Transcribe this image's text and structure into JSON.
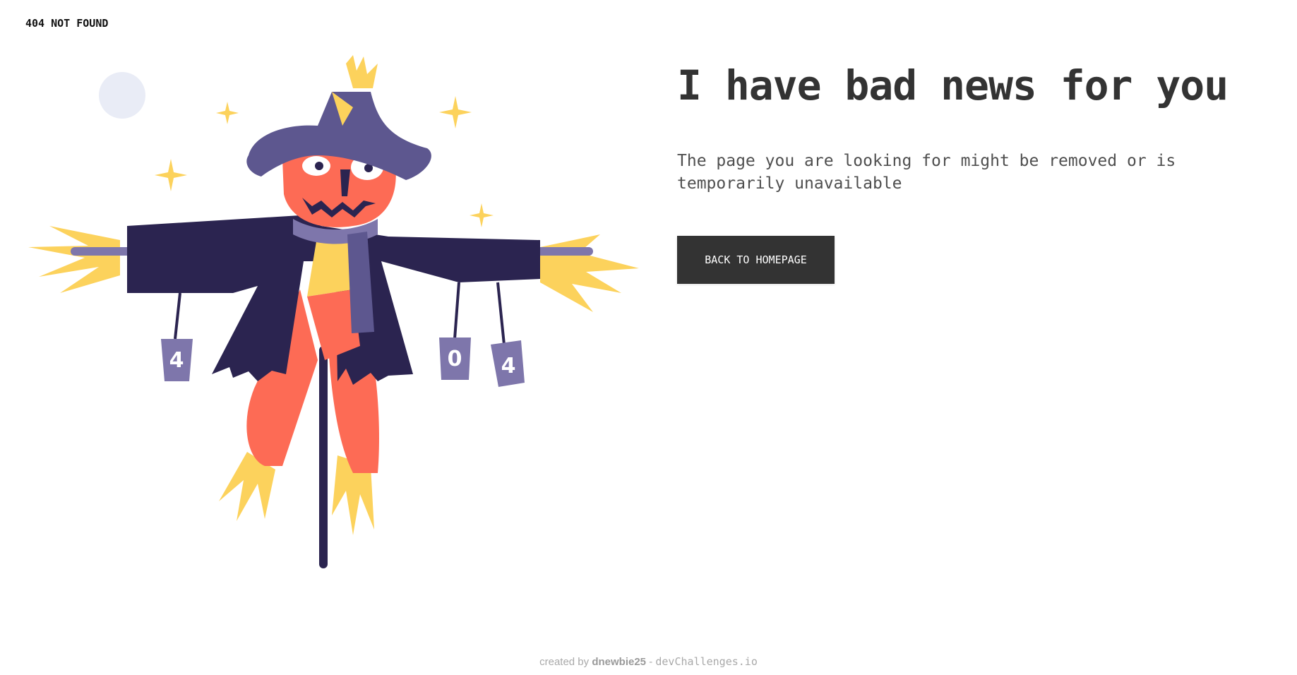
{
  "header": {
    "brand": "404 NOT FOUND"
  },
  "main": {
    "headline": "I have bad news for you",
    "message": "The page you are looking for might be removed or is temporarily unavailable",
    "button_label": "BACK TO HOMEPAGE"
  },
  "illustration": {
    "can_labels": [
      "4",
      "0",
      "4"
    ],
    "colors": {
      "hat": "#5d578f",
      "face": "#fd6b55",
      "coat": "#2b2450",
      "straw": "#fcd25c",
      "scarf": "#7e76ab",
      "moon": "#e9ecf6",
      "pole": "#2b2450"
    }
  },
  "footer": {
    "prefix": "created by",
    "author": "dnewbie25",
    "separator": "-",
    "site": "devChallenges.io"
  },
  "colors": {
    "text_primary": "#333333",
    "button_bg": "#333333",
    "button_text": "#ffffff",
    "footer_text": "#a9a9a9"
  }
}
